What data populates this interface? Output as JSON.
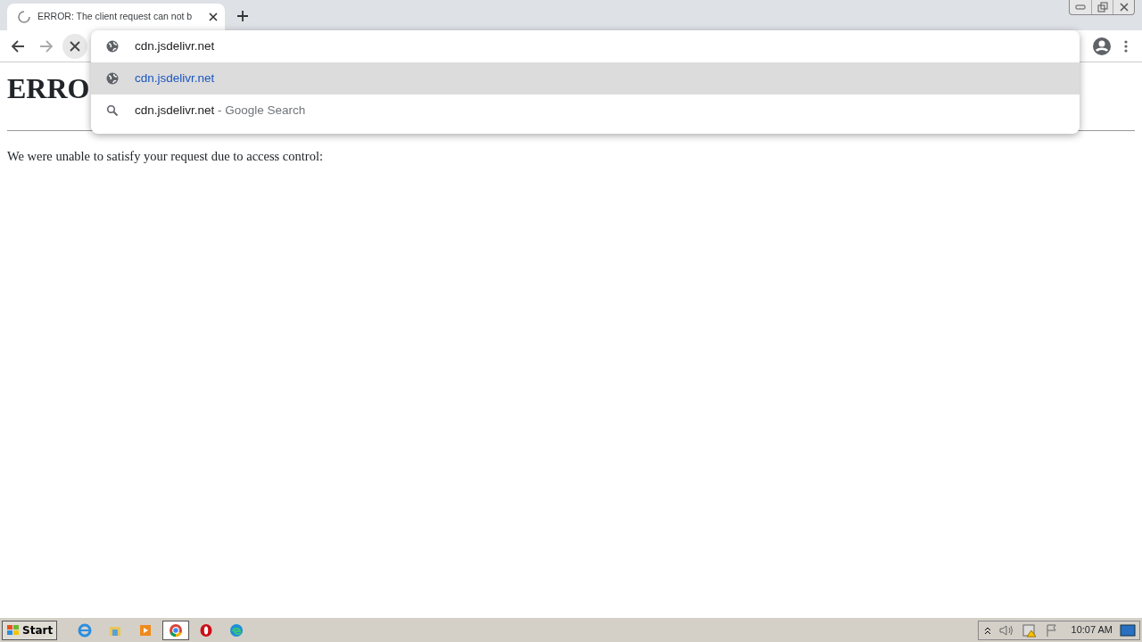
{
  "tab": {
    "title": "ERROR: The client request can not b",
    "loading": true
  },
  "address_bar": {
    "value": "cdn.jsdelivr.net"
  },
  "suggestions": [
    {
      "kind": "url",
      "text": "cdn.jsdelivr.net",
      "selected": true
    },
    {
      "kind": "search",
      "text": "cdn.jsdelivr.net",
      "suffix": "- Google Search",
      "selected": false
    }
  ],
  "page": {
    "heading": "ERRO",
    "message": "We were unable to satisfy your request due to access control:"
  },
  "taskbar": {
    "start": "Start",
    "apps": [
      {
        "kind": "ie",
        "active": false
      },
      {
        "kind": "folder",
        "active": false
      },
      {
        "kind": "media",
        "active": false
      },
      {
        "kind": "chrome",
        "active": true
      },
      {
        "kind": "opera",
        "active": false
      },
      {
        "kind": "edge",
        "active": false
      }
    ],
    "clock": "10:07 AM"
  }
}
